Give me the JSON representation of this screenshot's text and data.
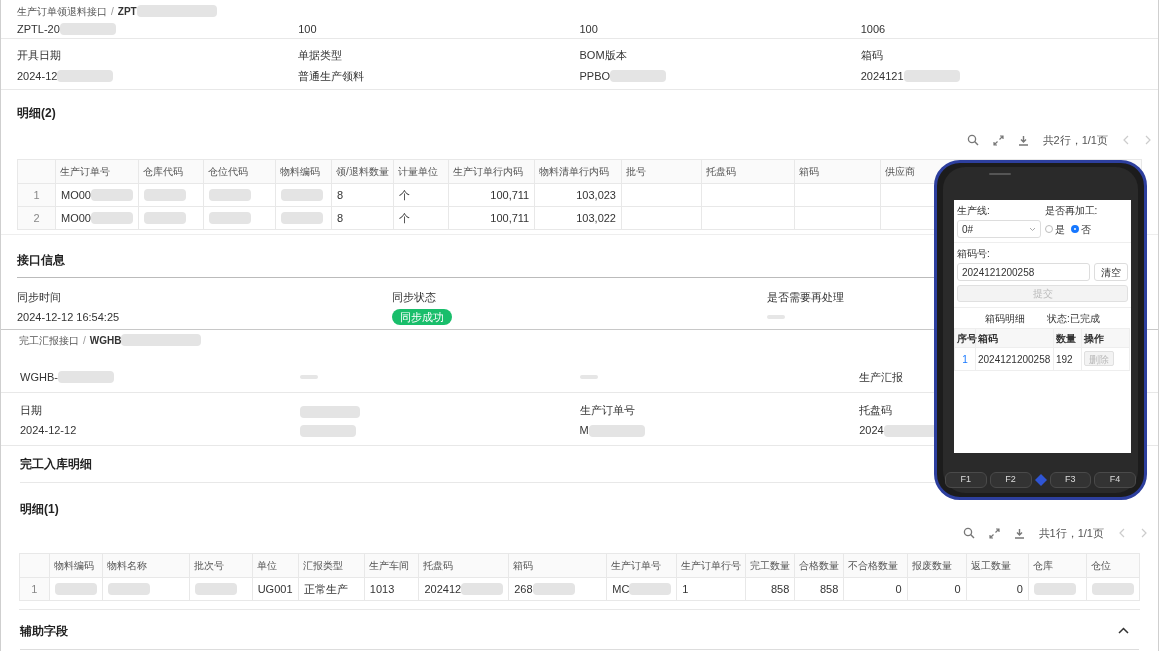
{
  "top_panel": {
    "breadcrumb": {
      "parent": "生产订单领退料接口",
      "separator": "/",
      "current": {
        "text": "ZPT",
        "blurred": true
      }
    },
    "partial_row": [
      {
        "kind": "text",
        "value": {
          "text": "ZPTL-20",
          "blurred": true
        }
      },
      {
        "kind": "text",
        "value": {
          "text": "100",
          "blurred": false
        }
      },
      {
        "kind": "text",
        "value": {
          "text": "100",
          "blurred": false
        }
      },
      {
        "kind": "text",
        "value": {
          "text": "1006",
          "blurred": false
        }
      }
    ],
    "fields": [
      {
        "kind": "text",
        "label": {
          "text": "开具日期",
          "blurred": false
        },
        "value": {
          "text": "2024-12",
          "blurred": true
        }
      },
      {
        "kind": "text",
        "label": {
          "text": "单据类型",
          "blurred": false
        },
        "value": {
          "text": "普通生产领料",
          "blurred": false
        }
      },
      {
        "kind": "text",
        "label": {
          "text": "BOM版本",
          "blurred": false
        },
        "value": {
          "text": "PPBO",
          "blurred": true
        }
      },
      {
        "kind": "text",
        "label": {
          "text": "箱码",
          "blurred": false
        },
        "value": {
          "text": "2024121",
          "blurred": true
        }
      }
    ],
    "detail": {
      "title": "明细(2)",
      "pager": "共2行，1/1页",
      "columns": [
        {
          "title": "生产订单号",
          "numeric": false
        },
        {
          "title": "仓库代码",
          "numeric": false
        },
        {
          "title": "仓位代码",
          "numeric": false
        },
        {
          "title": "物料编码",
          "numeric": false
        },
        {
          "title": "领/退料数量",
          "numeric": false
        },
        {
          "title": "计量单位",
          "numeric": false
        },
        {
          "title": "生产订单行内码",
          "numeric": true
        },
        {
          "title": "物料清单行内码",
          "numeric": true
        },
        {
          "title": "批号",
          "numeric": false
        },
        {
          "title": "托盘码",
          "numeric": false
        },
        {
          "title": "箱码",
          "numeric": false
        },
        {
          "title": "供应商",
          "numeric": false
        }
      ],
      "rows": [
        {
          "index": "1",
          "cells": [
            {
              "text": "MO00",
              "blurred": true
            },
            {
              "blurred": true
            },
            {
              "blurred": true
            },
            {
              "blurred": true
            },
            {
              "text": "8",
              "blurred": false
            },
            {
              "text": "个",
              "blurred": false
            },
            {
              "text": "100,711",
              "blurred": false
            },
            {
              "text": "103,023",
              "blurred": false
            },
            {
              "blurred": false
            },
            {
              "blurred": false
            },
            {
              "blurred": false
            },
            {
              "blurred": false
            }
          ]
        },
        {
          "index": "2",
          "cells": [
            {
              "text": "MO00",
              "blurred": true
            },
            {
              "blurred": true
            },
            {
              "blurred": true
            },
            {
              "blurred": true
            },
            {
              "text": "8",
              "blurred": false
            },
            {
              "text": "个",
              "blurred": false
            },
            {
              "text": "100,711",
              "blurred": false
            },
            {
              "text": "103,022",
              "blurred": false
            },
            {
              "blurred": false
            },
            {
              "blurred": false
            },
            {
              "blurred": false
            },
            {
              "blurred": false
            }
          ]
        }
      ]
    },
    "interface": {
      "title": "接口信息",
      "fields": [
        {
          "kind": "text",
          "label": {
            "text": "同步时间",
            "blurred": false
          },
          "value": {
            "text": "2024-12-12 16:54:25",
            "blurred": false
          }
        },
        {
          "kind": "badge",
          "label": {
            "text": "同步状态",
            "blurred": false
          },
          "value": {
            "text": "同步成功"
          }
        },
        {
          "kind": "dash",
          "label": {
            "text": "是否需要再处理",
            "blurred": false
          }
        }
      ]
    }
  },
  "bottom_panel": {
    "breadcrumb": {
      "parent": "完工汇报接口",
      "separator": "/",
      "current": {
        "text": "WGHB",
        "blurred": true
      }
    },
    "field_rows": [
      [
        {
          "kind": "text",
          "value": {
            "text": "WGHB-",
            "blurred": true
          }
        },
        {
          "kind": "dash"
        },
        {
          "kind": "dash"
        },
        {
          "kind": "text",
          "value": {
            "text": "生产汇报",
            "blurred": false
          }
        }
      ],
      [
        {
          "kind": "text",
          "label": {
            "text": "日期",
            "blurred": false
          },
          "value": {
            "text": "2024-12-12",
            "blurred": false
          }
        },
        {
          "kind": "text",
          "label": {
            "blurred": true
          },
          "value": {
            "blurred": true
          }
        },
        {
          "kind": "text",
          "label": {
            "text": "生产订单号",
            "blurred": false
          },
          "value": {
            "text": "M",
            "blurred": true
          }
        },
        {
          "kind": "text",
          "label": {
            "text": "托盘码",
            "blurred": false
          },
          "value": {
            "text": "2024",
            "blurred": true
          }
        }
      ]
    ],
    "section_title": "完工入库明细",
    "detail": {
      "title": "明细(1)",
      "pager": "共1行，1/1页",
      "columns": [
        {
          "title": "物料编码",
          "numeric": false
        },
        {
          "title": "物料名称",
          "numeric": false
        },
        {
          "title": "批次号",
          "numeric": false
        },
        {
          "title": "单位",
          "numeric": false
        },
        {
          "title": "汇报类型",
          "numeric": false
        },
        {
          "title": "生产车间",
          "numeric": false
        },
        {
          "title": "托盘码",
          "numeric": false
        },
        {
          "title": "箱码",
          "numeric": false
        },
        {
          "title": "生产订单号",
          "numeric": false
        },
        {
          "title": "生产订单行号",
          "numeric": false
        },
        {
          "title": "完工数量",
          "numeric": true
        },
        {
          "title": "合格数量",
          "numeric": true
        },
        {
          "title": "不合格数量",
          "numeric": true
        },
        {
          "title": "报废数量",
          "numeric": true
        },
        {
          "title": "返工数量",
          "numeric": true
        },
        {
          "title": "仓库",
          "numeric": false
        },
        {
          "title": "仓位",
          "numeric": false
        }
      ],
      "rows": [
        {
          "index": "1",
          "cells": [
            {
              "blurred": true
            },
            {
              "blurred": true
            },
            {
              "blurred": true
            },
            {
              "text": "UG001",
              "blurred": false
            },
            {
              "text": "正常生产",
              "blurred": false
            },
            {
              "text": "1013",
              "blurred": false
            },
            {
              "text": "202412",
              "blurred": true
            },
            {
              "text": "268",
              "blurred": true
            },
            {
              "text": "MC",
              "blurred": true
            },
            {
              "text": "1",
              "blurred": false
            },
            {
              "text": "858",
              "blurred": false
            },
            {
              "text": "858",
              "blurred": false
            },
            {
              "text": "0",
              "blurred": false
            },
            {
              "text": "0",
              "blurred": false
            },
            {
              "text": "0",
              "blurred": false
            },
            {
              "blurred": true
            },
            {
              "blurred": true
            }
          ]
        }
      ]
    },
    "aux_section": {
      "title": "辅助字段",
      "expanded": true
    }
  },
  "handheld": {
    "line_label": "生产线:",
    "line_value": "0#",
    "rework_label": "是否再加工:",
    "options": [
      {
        "label": "是",
        "selected": false
      },
      {
        "label": "否",
        "selected": true
      }
    ],
    "box_label": "箱码号:",
    "box_value": "2024121200258",
    "clear_button": "清空",
    "submit": {
      "label": "提交",
      "disabled": true
    },
    "detail_title": "箱码明细",
    "status": "状态:已完成",
    "columns": [
      "序号",
      "箱码",
      "数量",
      "操作"
    ],
    "rows": [
      {
        "index": "1",
        "code": "2024121200258",
        "qty": "192",
        "action": "删除",
        "action_disabled": true
      }
    ],
    "keys": [
      "F1",
      "F2",
      "F3",
      "F4"
    ]
  }
}
